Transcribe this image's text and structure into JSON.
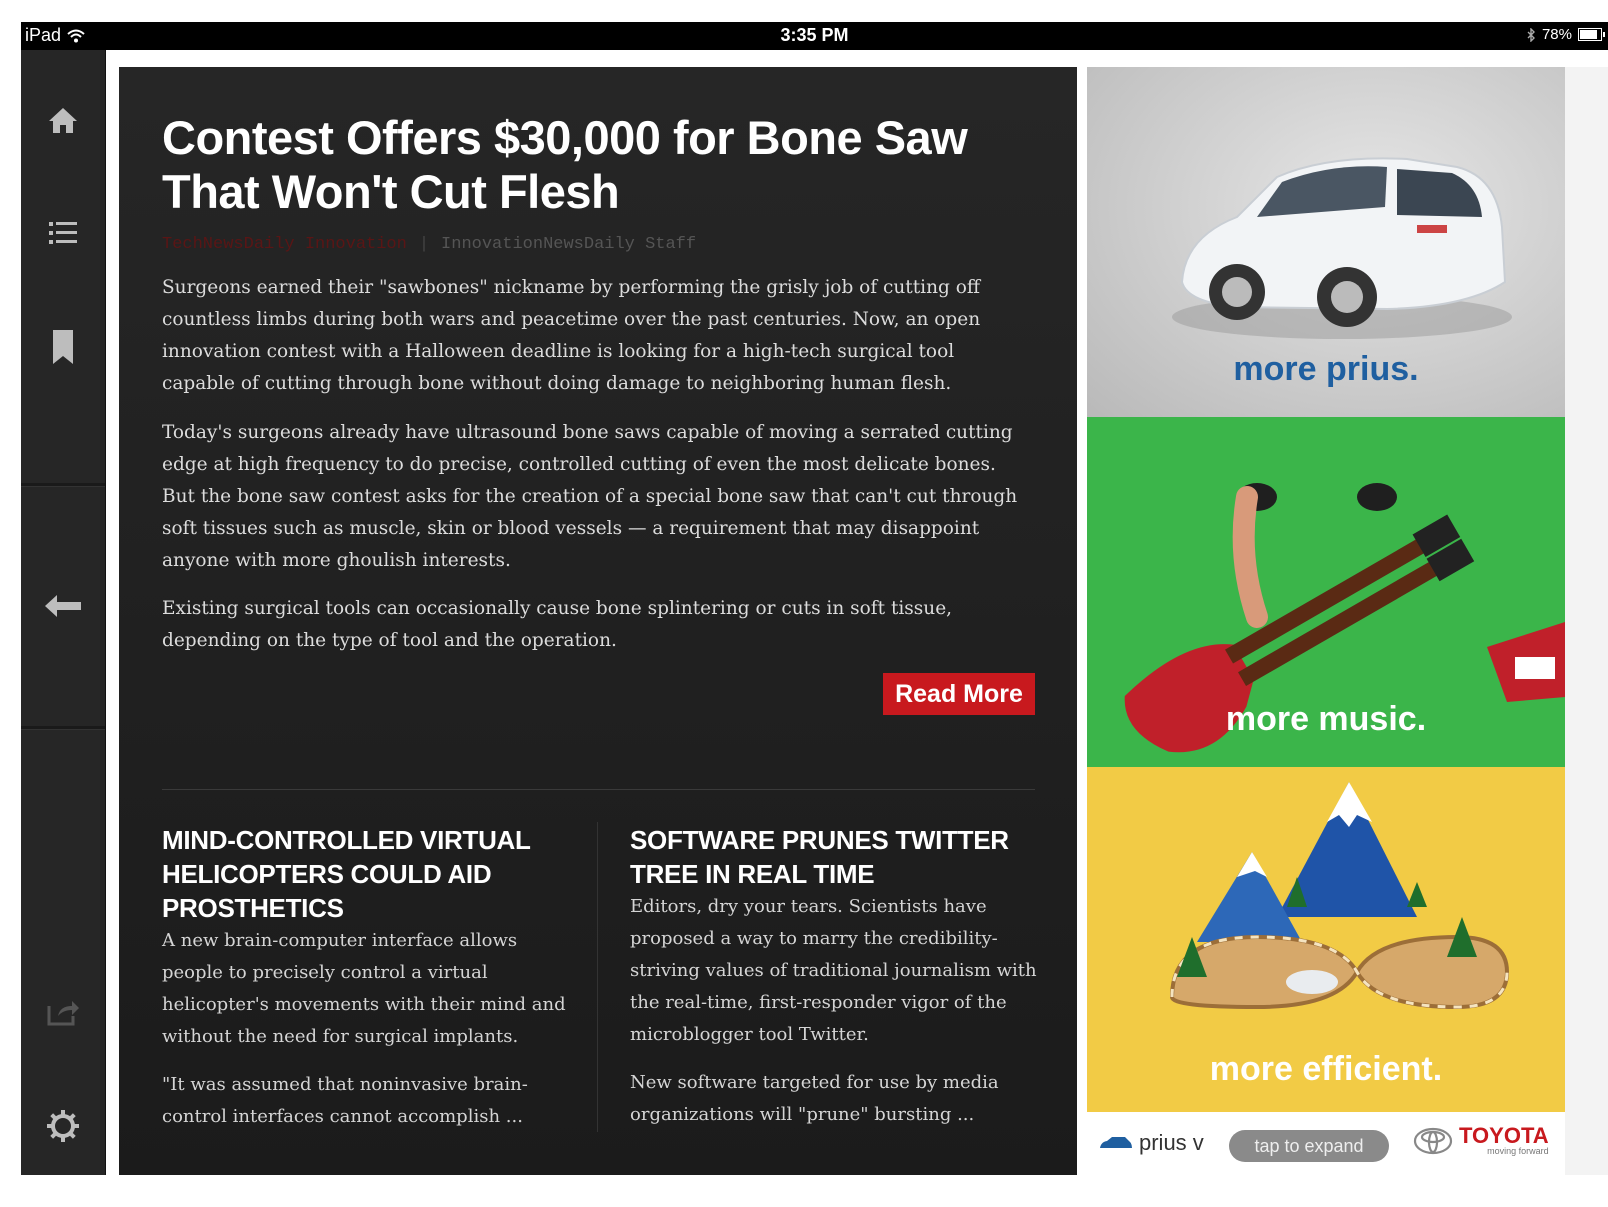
{
  "status_bar": {
    "device": "iPad",
    "time": "3:35 PM",
    "battery": "78%",
    "battery_level": 0.78
  },
  "sidebar": {
    "icons": [
      "home-icon",
      "list-icon",
      "bookmark-icon",
      "back-arrow-icon",
      "share-icon",
      "gear-icon"
    ]
  },
  "article": {
    "headline": "Contest Offers $30,000 for Bone Saw That Won't Cut Flesh",
    "category": "TechNewsDaily Innovation",
    "author": "InnovationNewsDaily Staff",
    "paragraphs": [
      "Surgeons earned their \"sawbones\" nickname by performing the grisly job of cutting off countless limbs during both wars and peacetime over the past centuries. Now, an open innovation contest with a Halloween deadline is looking for a high-tech surgical tool capable of cutting through bone without doing damage to neighboring human flesh.",
      "Today's surgeons already have ultrasound bone saws capable of moving a serrated cutting edge at high frequency to do precise, controlled cutting of even the most delicate bones. But the bone saw contest asks for the creation of a special bone saw that can't cut through soft tissues such as muscle, skin or blood vessels — a requirement that may disappoint anyone with more ghoulish interests.",
      "Existing surgical tools can occasionally cause bone splintering or cuts in soft tissue, depending on the type of tool and the operation."
    ],
    "read_more": "Read More"
  },
  "stories": [
    {
      "title": "MIND-CONTROLLED VIRTUAL HELICOPTERS COULD AID PROSTHETICS",
      "summary": "A new brain-computer interface allows people to precisely control a virtual helicopter's movements with their mind and without the need for surgical implants.",
      "excerpt": "\"It was assumed that noninvasive brain-control interfaces cannot accomplish ..."
    },
    {
      "title": "SOFTWARE PRUNES TWITTER TREE IN REAL TIME",
      "summary": "Editors, dry your tears. Scientists have proposed a way to marry the credibility-striving values of traditional journalism with the real-time, first-responder vigor of the microblogger tool Twitter.",
      "excerpt": "New software targeted for use by media organizations will \"prune\" bursting ..."
    }
  ],
  "ad": {
    "panels": [
      {
        "tagline": "more prius.",
        "color": "#1f5fa0"
      },
      {
        "tagline": "more music.",
        "color": "#ffffff"
      },
      {
        "tagline": "more efficient.",
        "color": "#ffffff"
      }
    ],
    "model": "prius v",
    "tap_to_expand": "tap to expand",
    "brand": "TOYOTA",
    "slogan": "moving forward"
  },
  "colors": {
    "accent_red": "#c8191e",
    "panel_bg": "#1e1e1e",
    "sidebar_bg": "#262626"
  }
}
